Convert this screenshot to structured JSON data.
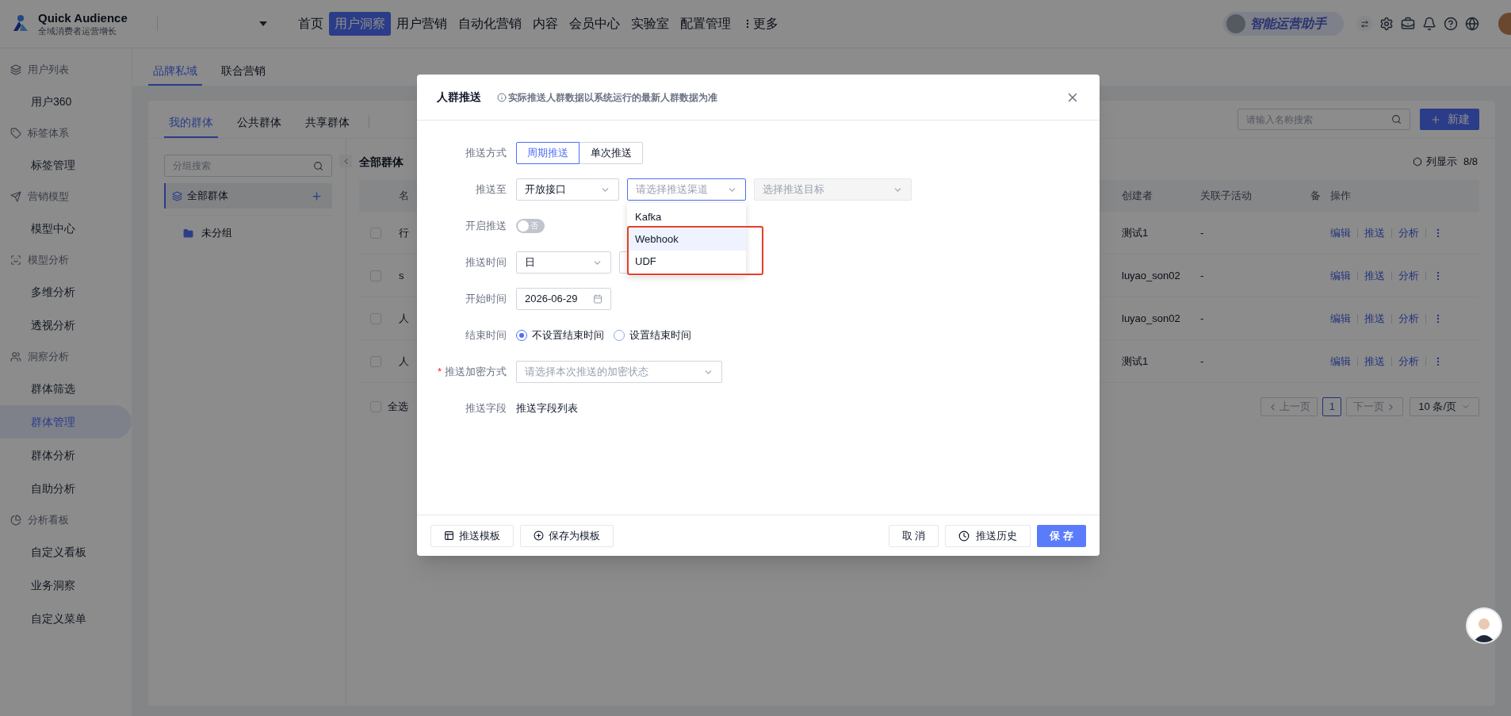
{
  "header": {
    "logo_title": "Quick Audience",
    "logo_subtitle": "全域消费者运营增长",
    "nav": [
      {
        "label": "首页",
        "selected": false
      },
      {
        "label": "用户洞察",
        "selected": true
      },
      {
        "label": "用户营销",
        "selected": false
      },
      {
        "label": "自动化营销",
        "selected": false
      },
      {
        "label": "内容",
        "selected": false
      },
      {
        "label": "会员中心",
        "selected": false
      },
      {
        "label": "实验室",
        "selected": false
      },
      {
        "label": "配置管理",
        "selected": false
      },
      {
        "label": "更多",
        "selected": false,
        "kind": "more"
      }
    ],
    "assistant": "智能运营助手"
  },
  "sidebar": {
    "groups": [
      {
        "title": "用户列表",
        "items": [
          {
            "label": "用户360",
            "selected": false
          }
        ]
      },
      {
        "title": "标签体系",
        "items": [
          {
            "label": "标签管理",
            "selected": false
          }
        ]
      },
      {
        "title": "营销模型",
        "items": [
          {
            "label": "模型中心",
            "selected": false
          }
        ]
      },
      {
        "title": "模型分析",
        "items": [
          {
            "label": "多维分析",
            "selected": false
          },
          {
            "label": "透视分析",
            "selected": false
          }
        ]
      },
      {
        "title": "洞察分析",
        "items": [
          {
            "label": "群体筛选",
            "selected": false
          },
          {
            "label": "群体管理",
            "selected": true
          },
          {
            "label": "群体分析",
            "selected": false
          },
          {
            "label": "自助分析",
            "selected": false
          }
        ]
      },
      {
        "title": "分析看板",
        "items": [
          {
            "label": "自定义看板",
            "selected": false
          },
          {
            "label": "业务洞察",
            "selected": false
          },
          {
            "label": "自定义菜单",
            "selected": false
          }
        ]
      }
    ]
  },
  "top_tabs": [
    {
      "label": "品牌私域",
      "selected": true
    },
    {
      "label": "联合营销",
      "selected": false
    }
  ],
  "group_tabs": [
    {
      "label": "我的群体",
      "selected": true
    },
    {
      "label": "公共群体",
      "selected": false
    },
    {
      "label": "共享群体",
      "selected": false
    }
  ],
  "search_placeholder": "请输入名称搜索",
  "new_button": "新建",
  "group_panel": {
    "search_placeholder": "分组搜索",
    "tree": [
      {
        "label": "全部群体",
        "selected": true,
        "children": [
          {
            "label": "未分组",
            "selected": false
          }
        ]
      }
    ]
  },
  "list": {
    "title": "全部群体",
    "column_display": "列显示",
    "column_count": "8/8",
    "columns": [
      "名",
      "创建者",
      "关联子活动",
      "备",
      "操作"
    ],
    "rows": [
      {
        "checked": false,
        "name": "行",
        "creator": "测试1",
        "activity": "-",
        "actions": [
          "编辑",
          "推送",
          "分析"
        ]
      },
      {
        "checked": false,
        "name": "s",
        "creator": "luyao_son02",
        "activity": "-",
        "actions": [
          "编辑",
          "推送",
          "分析"
        ]
      },
      {
        "checked": false,
        "name": "人",
        "creator": "luyao_son02",
        "activity": "-",
        "actions": [
          "编辑",
          "推送",
          "分析"
        ]
      },
      {
        "checked": false,
        "name": "人",
        "creator": "测试1",
        "activity": "-",
        "actions": [
          "编辑",
          "推送",
          "分析"
        ]
      }
    ],
    "select_all": {
      "label": "全选",
      "checked": false
    },
    "pagination": {
      "prev": "上一页",
      "pages": [
        {
          "label": "1",
          "selected": true
        }
      ],
      "next": "下一页",
      "page_size": "10 条/页"
    }
  },
  "modal": {
    "title": "人群推送",
    "notice": "实际推送人群数据以系统运行的最新人群数据为准",
    "fields": [
      {
        "kind": "segmented",
        "label": "推送方式",
        "options": [
          {
            "label": "周期推送",
            "selected": true
          },
          {
            "label": "单次推送",
            "selected": false
          }
        ]
      },
      {
        "kind": "selects",
        "label": "推送至",
        "selects": [
          {
            "value": "开放接口",
            "disabled": false,
            "focused": false
          },
          {
            "placeholder": "请选择推送渠道",
            "disabled": false,
            "focused": true,
            "dropdown": [
              {
                "label": "Kafka",
                "highlighted": false,
                "marked": false
              },
              {
                "label": "Webhook",
                "highlighted": true,
                "marked": true
              },
              {
                "label": "UDF",
                "highlighted": false,
                "marked": true
              }
            ]
          },
          {
            "placeholder": "选择推送目标",
            "disabled": true,
            "focused": false
          }
        ]
      },
      {
        "kind": "toggle",
        "label": "开启推送",
        "on": false,
        "text": "否"
      },
      {
        "kind": "selects",
        "label": "推送时间",
        "selects": [
          {
            "value": "日",
            "disabled": false,
            "focused": false
          },
          {
            "disabled": false,
            "focused": false
          }
        ]
      },
      {
        "kind": "date",
        "label": "开始时间",
        "value": "2026-06-29"
      },
      {
        "kind": "radio",
        "label": "结束时间",
        "options": [
          {
            "label": "不设置结束时间",
            "selected": true
          },
          {
            "label": "设置结束时间",
            "selected": false
          }
        ]
      },
      {
        "kind": "selects",
        "label": "推送加密方式",
        "required_mark": "*",
        "selects": [
          {
            "placeholder": "请选择本次推送的加密状态",
            "disabled": false,
            "focused": false
          }
        ]
      },
      {
        "kind": "text",
        "label": "推送字段",
        "value": "推送字段列表"
      }
    ],
    "footer_left": [
      {
        "label": "推送模板"
      },
      {
        "label": "保存为模板"
      }
    ],
    "footer_right": [
      {
        "label": "取 消",
        "kind": "plain"
      },
      {
        "label": "推送历史",
        "kind": "history"
      },
      {
        "label": "保 存",
        "kind": "primary"
      }
    ]
  }
}
